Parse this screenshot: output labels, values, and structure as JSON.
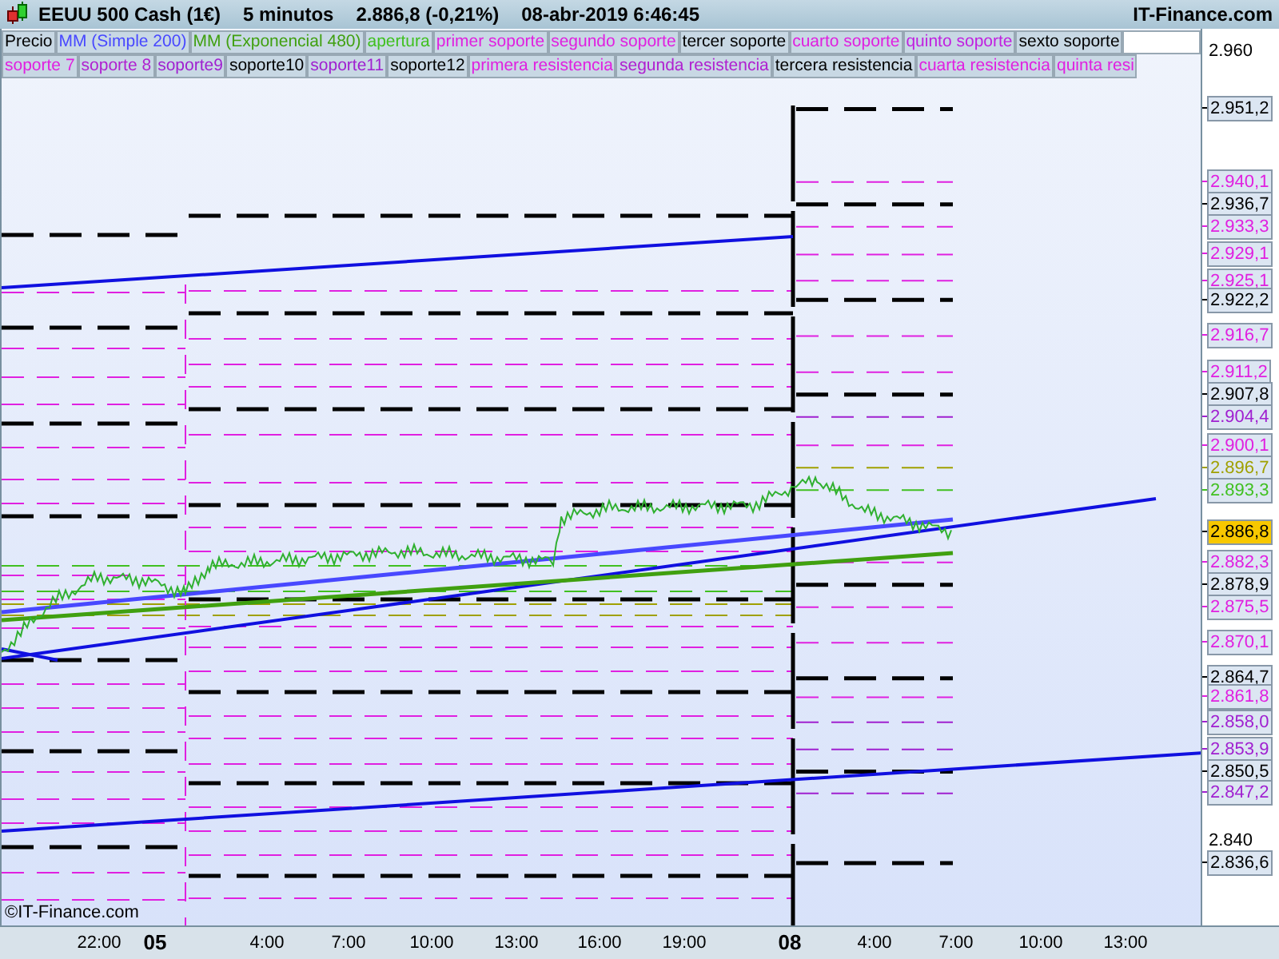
{
  "header": {
    "title": "EEUU 500 Cash (1€)",
    "interval": "5 minutos",
    "price": "2.886,8 (-0,21%)",
    "datetime": "08-abr-2019 6:46:45",
    "brand": "IT-Finance.com"
  },
  "legend": [
    [
      {
        "label": "Precio",
        "color": "#000000"
      },
      {
        "label": "MM (Simple 200)",
        "color": "#4848ff"
      },
      {
        "label": "MM (Exponencial 480)",
        "color": "#40a010"
      },
      {
        "label": "apertura",
        "color": "#40c020"
      },
      {
        "label": "primer soporte",
        "color": "#e020e0"
      },
      {
        "label": "segundo soporte",
        "color": "#e020e0"
      },
      {
        "label": "tercer soporte",
        "color": "#000000"
      },
      {
        "label": "cuarto soporte",
        "color": "#e020e0"
      },
      {
        "label": "quinto soporte",
        "color": "#c020e0"
      },
      {
        "label": "sexto soporte",
        "color": "#000000"
      }
    ],
    [
      {
        "label": "soporte 7",
        "color": "#e020e0"
      },
      {
        "label": "soporte 8",
        "color": "#b020d0"
      },
      {
        "label": "soporte9",
        "color": "#a020d0"
      },
      {
        "label": "soporte10",
        "color": "#000000"
      },
      {
        "label": "soporte11",
        "color": "#a020d0"
      },
      {
        "label": "soporte12",
        "color": "#000000"
      },
      {
        "label": "primera resistencia",
        "color": "#e020e0"
      },
      {
        "label": "segunda resistencia",
        "color": "#b020d0"
      },
      {
        "label": "tercera resistencia",
        "color": "#000000"
      },
      {
        "label": "cuarta resistencia",
        "color": "#e020e0"
      },
      {
        "label": "quinta resi",
        "color": "#e020e0"
      }
    ]
  ],
  "price_axis": {
    "ticks": [
      "2.960",
      "2.840"
    ],
    "labels": [
      {
        "text": "2.951,2",
        "color": "#000000",
        "current": false
      },
      {
        "text": "2.940,1",
        "color": "#e020e0",
        "current": false
      },
      {
        "text": "2.936,7",
        "color": "#000000",
        "current": false
      },
      {
        "text": "2.933,3",
        "color": "#e020e0",
        "current": false
      },
      {
        "text": "2.929,1",
        "color": "#e020e0",
        "current": false
      },
      {
        "text": "2.925,1",
        "color": "#e020e0",
        "current": false
      },
      {
        "text": "2.922,2",
        "color": "#000000",
        "current": false
      },
      {
        "text": "2.916,7",
        "color": "#e020e0",
        "current": false
      },
      {
        "text": "2.911,2",
        "color": "#e020e0",
        "current": false
      },
      {
        "text": "2.907,8",
        "color": "#000000",
        "current": false
      },
      {
        "text": "2.904,4",
        "color": "#a020d0",
        "current": false
      },
      {
        "text": "2.900,1",
        "color": "#e020e0",
        "current": false
      },
      {
        "text": "2.896,7",
        "color": "#a0a000",
        "current": false
      },
      {
        "text": "2.893,3",
        "color": "#40c020",
        "current": false
      },
      {
        "text": "2.886,8",
        "color": "#000000",
        "current": true
      },
      {
        "text": "2.882,3",
        "color": "#e020e0",
        "current": false
      },
      {
        "text": "2.878,9",
        "color": "#000000",
        "current": false
      },
      {
        "text": "2.875,5",
        "color": "#e020e0",
        "current": false
      },
      {
        "text": "2.870,1",
        "color": "#e020e0",
        "current": false
      },
      {
        "text": "2.864,7",
        "color": "#000000",
        "current": false
      },
      {
        "text": "2.861,8",
        "color": "#e020e0",
        "current": false
      },
      {
        "text": "2.858,0",
        "color": "#a020d0",
        "current": false
      },
      {
        "text": "2.853,9",
        "color": "#a020d0",
        "current": false
      },
      {
        "text": "2.850,5",
        "color": "#000000",
        "current": false
      },
      {
        "text": "2.847,2",
        "color": "#a020d0",
        "current": false
      },
      {
        "text": "2.836,6",
        "color": "#000000",
        "current": false
      }
    ]
  },
  "time_axis": [
    {
      "label": "22:00",
      "bold": false
    },
    {
      "label": "05",
      "bold": true
    },
    {
      "label": "4:00",
      "bold": false
    },
    {
      "label": "7:00",
      "bold": false
    },
    {
      "label": "10:00",
      "bold": false
    },
    {
      "label": "13:00",
      "bold": false
    },
    {
      "label": "16:00",
      "bold": false
    },
    {
      "label": "19:00",
      "bold": false
    },
    {
      "label": "08",
      "bold": true
    },
    {
      "label": "4:00",
      "bold": false
    },
    {
      "label": "7:00",
      "bold": false
    },
    {
      "label": "10:00",
      "bold": false
    },
    {
      "label": "13:00",
      "bold": false
    }
  ],
  "credit": "©IT-Finance.com"
}
